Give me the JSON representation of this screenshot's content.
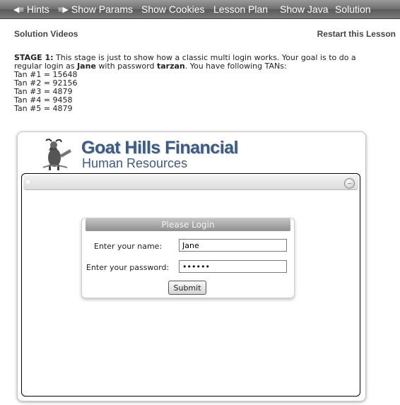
{
  "nav": {
    "hints": "Hints",
    "show_params": "Show Params",
    "show_cookies": "Show Cookies",
    "lesson_plan": "Lesson Plan",
    "show_java": "Show Java",
    "solution": "Solution"
  },
  "links": {
    "solution_videos": "Solution Videos",
    "restart_lesson": "Restart this Lesson"
  },
  "instructions": {
    "stage_label": "STAGE 1:",
    "text_1": " This stage is just to show how a classic multi login works. Your goal is to do a regular login as ",
    "user": "Jane",
    "text_2": " with password ",
    "password_hint": "tarzan",
    "text_3": ". You have following TANs:",
    "tans": [
      "Tan #1 = 15648",
      "Tan #2 = 92156",
      "Tan #3 = 4879",
      "Tan #4 = 9458",
      "Tan #5 = 4879"
    ]
  },
  "app": {
    "brand_title": "Goat Hills Financial",
    "brand_subtitle": "Human Resources",
    "login": {
      "title": "Please Login",
      "name_label": "Enter your name:",
      "name_value": "Jane",
      "password_label": "Enter your password:",
      "password_value": "••••••",
      "submit_label": "Submit"
    }
  },
  "colors": {
    "brand": "#3c5a82",
    "nav_bg": "#6e6e6e"
  }
}
